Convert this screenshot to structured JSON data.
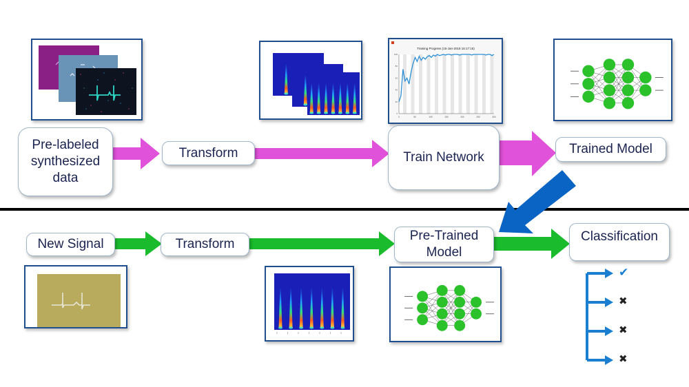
{
  "colors": {
    "training_arrow": "#e052d9",
    "inference_arrow": "#1bbb2e",
    "deploy_arrow": "#0a64c4",
    "node_text": "#1b2350",
    "thumb_border": "#1f4e8c",
    "classification_branch": "#1a7fd0",
    "neuron": "#2bc12b"
  },
  "training": {
    "nodes": [
      {
        "id": "pre-labeled",
        "label": "Pre-labeled synthesized data"
      },
      {
        "id": "transform",
        "label": "Transform"
      },
      {
        "id": "train-network",
        "label": "Train Network"
      },
      {
        "id": "trained-model",
        "label": "Trained Model"
      }
    ],
    "thumbnails": {
      "signals": "stacked synthesized ECG signal images",
      "spectrograms": "stacked time-frequency spectrograms",
      "training_plot_title": "Training Progress (15-Jan-2018 16:17:15)",
      "training_plot_ticks_x": [
        "0",
        "50",
        "100",
        "150",
        "200",
        "250",
        "300"
      ],
      "training_plot_ticks_y": [
        "0",
        "20",
        "40",
        "60",
        "80",
        "100"
      ],
      "network": "neural network diagram"
    }
  },
  "inference": {
    "nodes": [
      {
        "id": "new-signal",
        "label": "New Signal"
      },
      {
        "id": "transform",
        "label": "Transform"
      },
      {
        "id": "pre-trained-model",
        "label": "Pre-Trained Model"
      },
      {
        "id": "classification",
        "label": "Classification"
      }
    ],
    "classification_results": [
      {
        "result": "match",
        "glyph": "✔"
      },
      {
        "result": "no-match",
        "glyph": "✖"
      },
      {
        "result": "no-match",
        "glyph": "✖"
      },
      {
        "result": "no-match",
        "glyph": "✖"
      }
    ]
  }
}
